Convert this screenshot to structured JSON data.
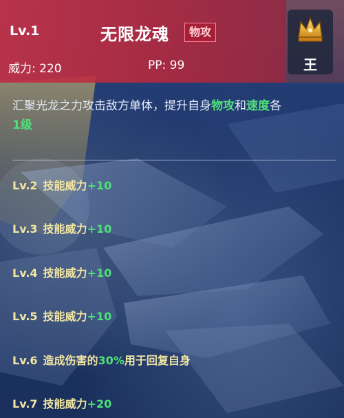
{
  "header": {
    "level": "Lv.1",
    "skill_name": "无限龙魂",
    "type_badge": "物攻",
    "power": "威力: 220",
    "pp": "PP: 99",
    "rank_label": "王",
    "rank_icon": "crown-icon"
  },
  "description": {
    "part1": "汇聚光龙之力攻击敌方单体，提升自身",
    "stat1": "物攻",
    "part2": "和",
    "stat2": "速度",
    "part3": "各",
    "amount": "1级"
  },
  "upgrades": [
    {
      "lv": "Lv.2",
      "text": "技能威力",
      "value": "+10",
      "suffix": ""
    },
    {
      "lv": "Lv.3",
      "text": "技能威力",
      "value": "+10",
      "suffix": ""
    },
    {
      "lv": "Lv.4",
      "text": "技能威力",
      "value": "+10",
      "suffix": ""
    },
    {
      "lv": "Lv.5",
      "text": "技能威力",
      "value": "+10",
      "suffix": ""
    },
    {
      "lv": "Lv.6",
      "text": "造成伤害的",
      "value": "30%",
      "suffix": "用于回复自身"
    },
    {
      "lv": "Lv.7",
      "text": "技能威力",
      "value": "+20",
      "suffix": ""
    }
  ],
  "colors": {
    "header_red": "#c43246",
    "accent_green": "#4fe07a",
    "upgrade_yellow": "#f2e6a2",
    "background_blue": "#1d3466"
  }
}
